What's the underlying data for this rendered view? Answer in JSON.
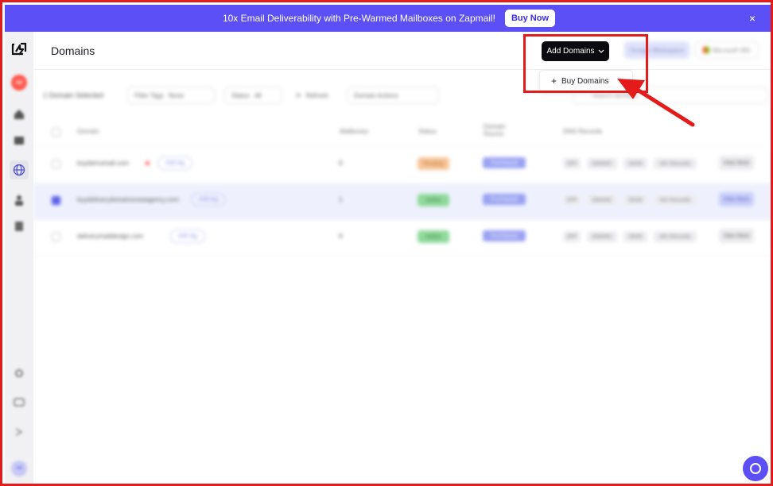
{
  "banner": {
    "text": "10x Email Deliverability with Pre-Warmed Mailboxes on Zapmail!",
    "button_label": "Buy Now",
    "close_glyph": "×"
  },
  "header": {
    "title": "Domains",
    "add_domains_label": "Add Domains",
    "google_workspace_label": "Google Workspace",
    "microsoft_label": "Microsoft 365"
  },
  "dropdown": {
    "items": [
      {
        "icon": "plus-icon",
        "label": "Buy Domains"
      }
    ]
  },
  "toolbar": {
    "selected_text": "1 Domain Selected",
    "filter_tags_label": "Filter Tags",
    "filter_tags_value": "None",
    "status_label": "Status",
    "status_value": "All",
    "refresh_label": "Refresh",
    "domain_actions_label": "Domain Actions",
    "search_placeholder": "Search domains"
  },
  "table": {
    "columns": [
      "Domain",
      "Mailboxes",
      "Status",
      "Domain Source",
      "DNS Records"
    ],
    "rows": [
      {
        "domain": "buydemomail.com",
        "tag": "Add tag",
        "mailboxes": "0",
        "status": "Pending",
        "source": "Purchased",
        "dns": [
          "SPF",
          "DMARC",
          "DKIM",
          "MX Records"
        ],
        "action": "View More",
        "selected": false,
        "alert": true
      },
      {
        "domain": "buydeliverydomainsnowagency.com",
        "tag": "Add tag",
        "mailboxes": "1",
        "status": "Active",
        "source": "Purchased",
        "dns": [
          "SPF",
          "DMARC",
          "DKIM",
          "MX Records"
        ],
        "action": "View More",
        "selected": true,
        "alert": false
      },
      {
        "domain": "deliverymaildesign.com",
        "tag": "Add tag",
        "mailboxes": "0",
        "status": "Active",
        "source": "Purchased",
        "dns": [
          "SPF",
          "DMARC",
          "DKIM",
          "MX Records"
        ],
        "action": "View More",
        "selected": false,
        "alert": false
      }
    ]
  },
  "sidebar": {
    "avatar_initials": "AB",
    "bottom_initials": "AB"
  },
  "colors": {
    "brand": "#5b4ff5",
    "annotation": "#e31b1b",
    "pending": "#f7c59b",
    "active": "#8fd99b",
    "source": "#9aa2f2"
  }
}
